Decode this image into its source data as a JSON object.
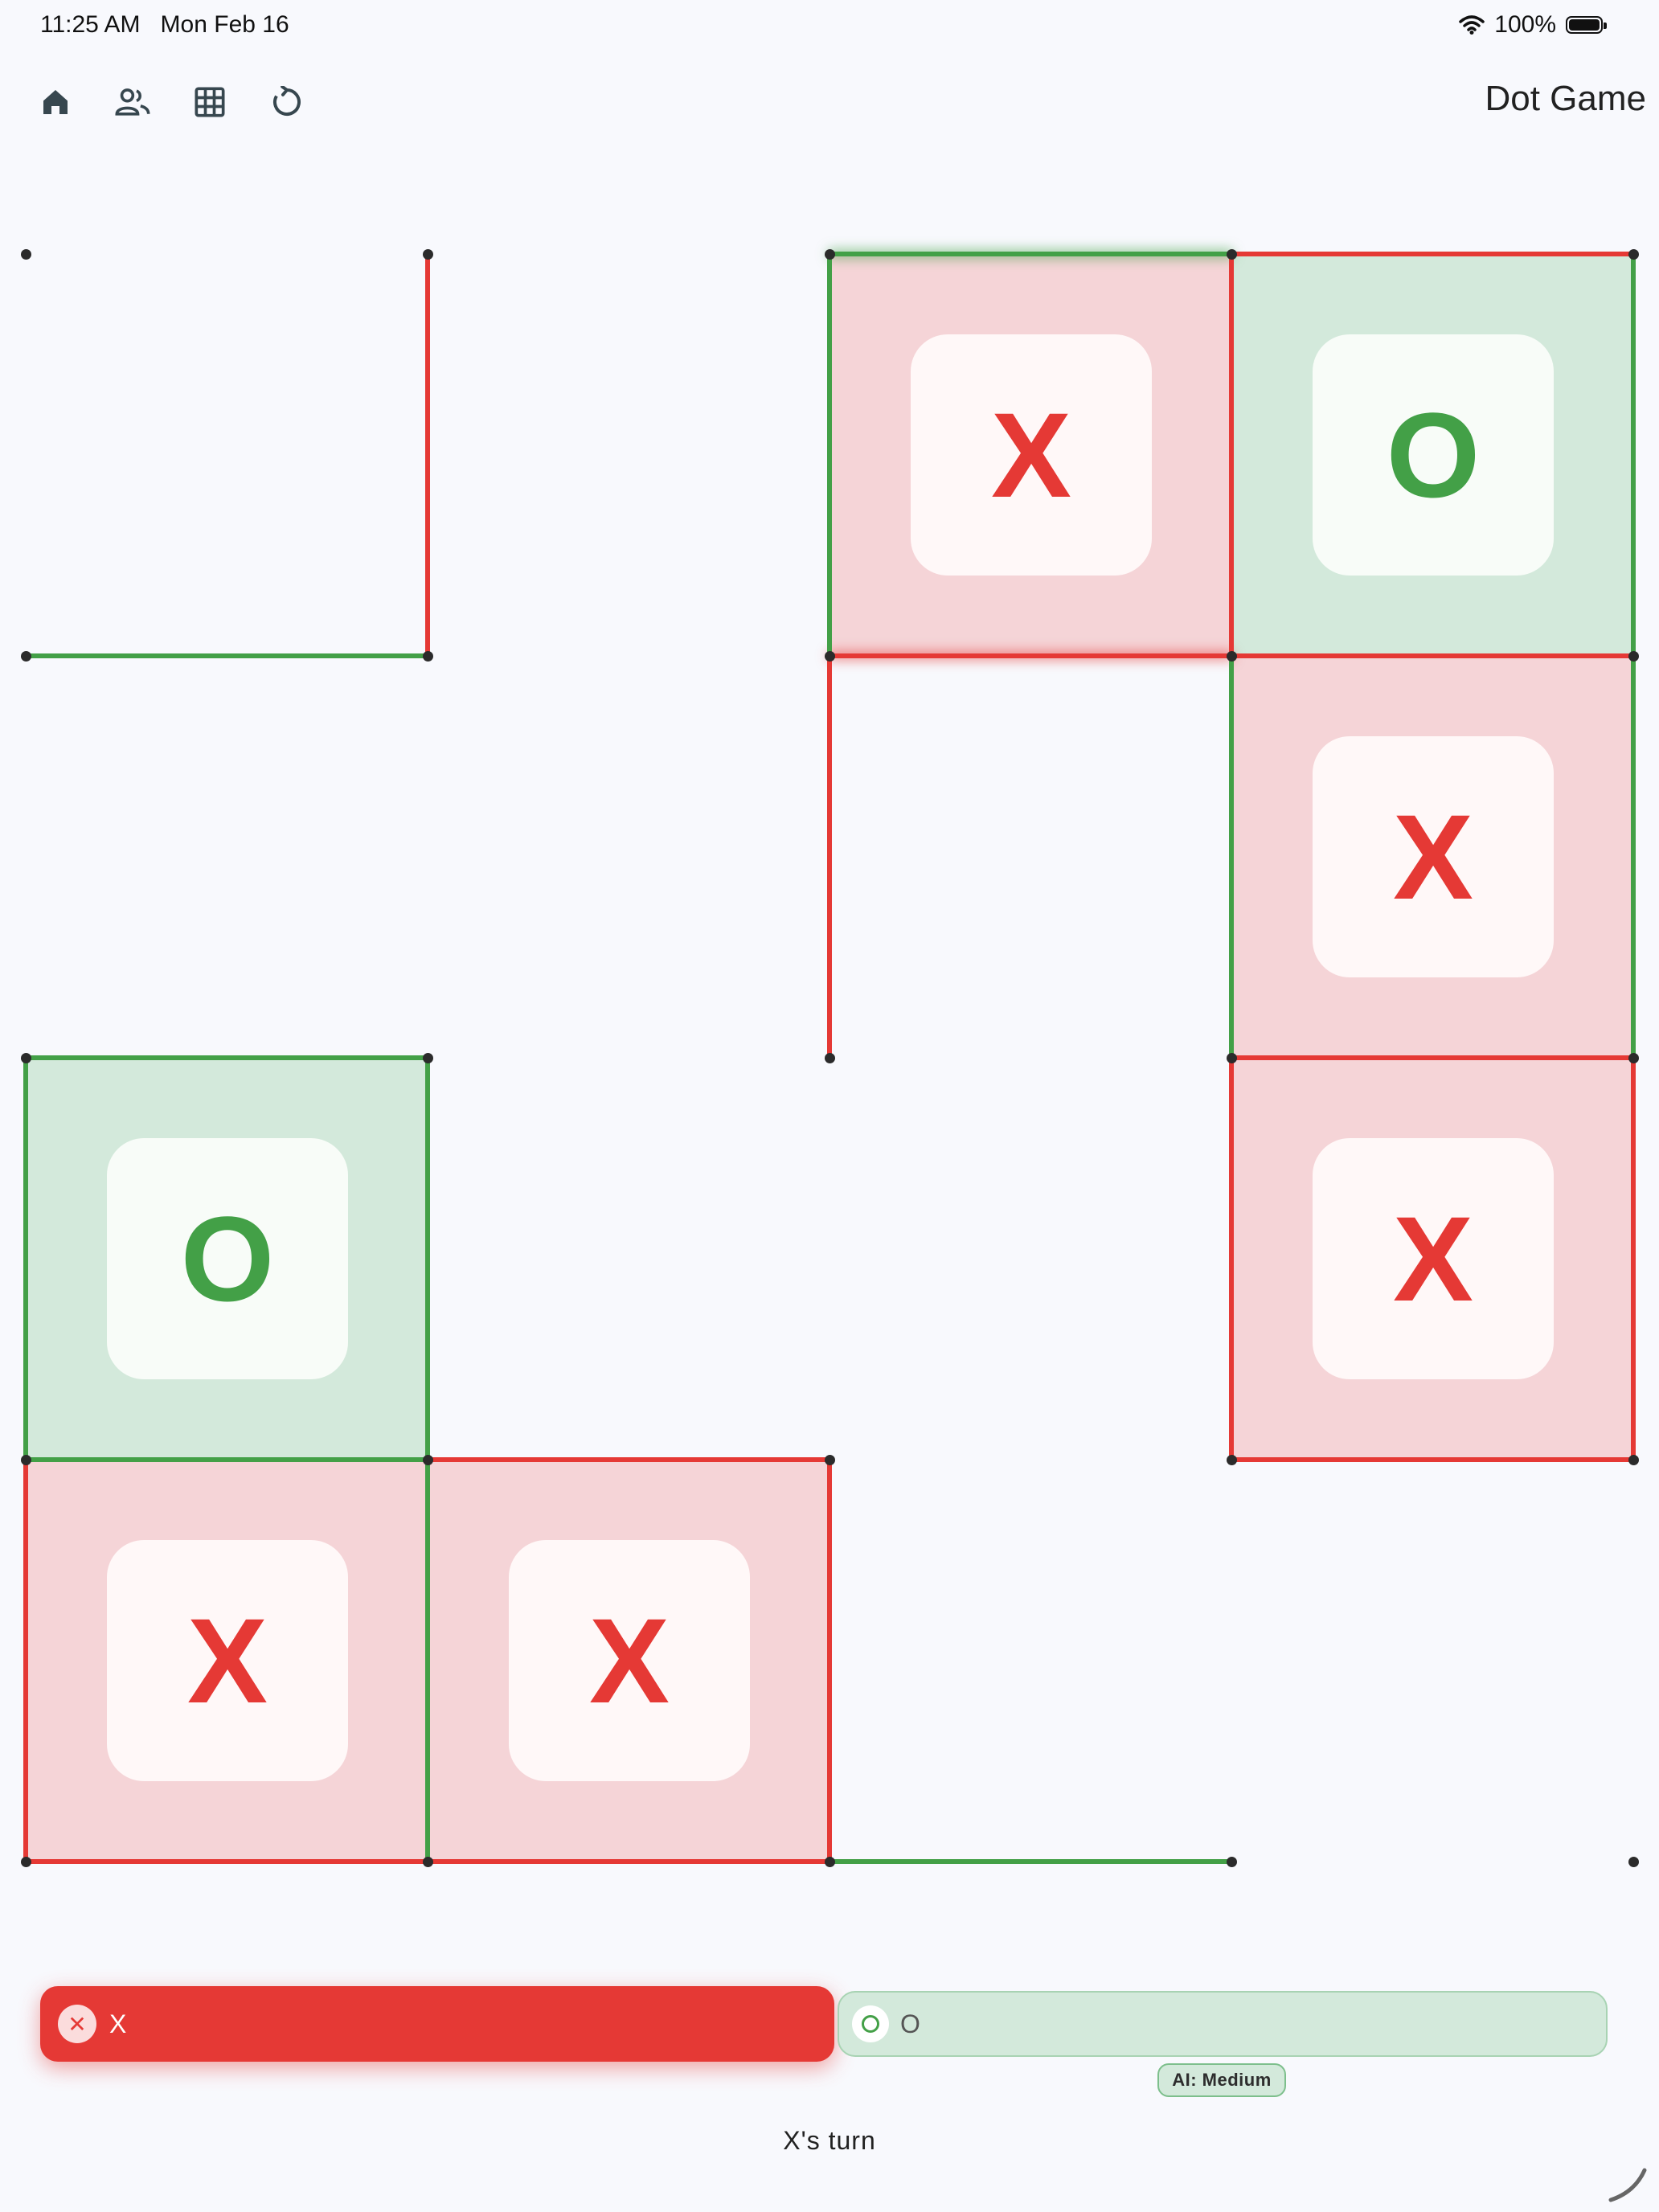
{
  "status_bar": {
    "time": "11:25 AM",
    "date": "Mon Feb 16",
    "battery": "100%",
    "wifi_icon": "wifi-icon",
    "battery_icon": "battery-icon"
  },
  "toolbar": {
    "buttons": [
      {
        "name": "home-button",
        "icon": "home-icon"
      },
      {
        "name": "players-button",
        "icon": "people-icon"
      },
      {
        "name": "grid-size-button",
        "icon": "grid-icon"
      },
      {
        "name": "restart-button",
        "icon": "refresh-icon"
      }
    ]
  },
  "app": {
    "title": "Dot Game"
  },
  "colors": {
    "player_x": "#e53935",
    "player_o": "#43a047",
    "cell_x_bg": "#f5d4d7",
    "cell_o_bg": "#d3e9db",
    "dot": "#2b2b2b",
    "background": "#f8f9fd"
  },
  "board": {
    "grid_dots": 5,
    "cells": [
      {
        "col": 2,
        "row": 0,
        "owner": "X",
        "mark": "X"
      },
      {
        "col": 3,
        "row": 0,
        "owner": "O",
        "mark": "O"
      },
      {
        "col": 3,
        "row": 1,
        "owner": "X",
        "mark": "X"
      },
      {
        "col": 3,
        "row": 2,
        "owner": "X",
        "mark": "X"
      },
      {
        "col": 0,
        "row": 2,
        "owner": "O",
        "mark": "O"
      },
      {
        "col": 0,
        "row": 3,
        "owner": "X",
        "mark": "X"
      },
      {
        "col": 1,
        "row": 3,
        "owner": "X",
        "mark": "X"
      }
    ],
    "h_lines": [
      {
        "col": 2,
        "row": 0,
        "player": "O",
        "last_move": true
      },
      {
        "col": 3,
        "row": 0,
        "player": "X"
      },
      {
        "col": 0,
        "row": 1,
        "player": "O"
      },
      {
        "col": 2,
        "row": 1,
        "player": "X",
        "last_move": true
      },
      {
        "col": 3,
        "row": 1,
        "player": "X"
      },
      {
        "col": 0,
        "row": 2,
        "player": "O"
      },
      {
        "col": 3,
        "row": 2,
        "player": "X"
      },
      {
        "col": 0,
        "row": 3,
        "player": "O"
      },
      {
        "col": 1,
        "row": 3,
        "player": "X"
      },
      {
        "col": 3,
        "row": 3,
        "player": "X"
      },
      {
        "col": 0,
        "row": 4,
        "player": "X"
      },
      {
        "col": 1,
        "row": 4,
        "player": "X"
      },
      {
        "col": 2,
        "row": 4,
        "player": "O"
      }
    ],
    "v_lines": [
      {
        "col": 1,
        "row": 0,
        "player": "X"
      },
      {
        "col": 2,
        "row": 0,
        "player": "O"
      },
      {
        "col": 3,
        "row": 0,
        "player": "X"
      },
      {
        "col": 4,
        "row": 0,
        "player": "O"
      },
      {
        "col": 2,
        "row": 1,
        "player": "X"
      },
      {
        "col": 3,
        "row": 1,
        "player": "O"
      },
      {
        "col": 4,
        "row": 1,
        "player": "O"
      },
      {
        "col": 0,
        "row": 2,
        "player": "O"
      },
      {
        "col": 1,
        "row": 2,
        "player": "O"
      },
      {
        "col": 3,
        "row": 2,
        "player": "X"
      },
      {
        "col": 4,
        "row": 2,
        "player": "X"
      },
      {
        "col": 0,
        "row": 3,
        "player": "X"
      },
      {
        "col": 1,
        "row": 3,
        "player": "O"
      },
      {
        "col": 2,
        "row": 3,
        "player": "X"
      }
    ]
  },
  "players": {
    "x": {
      "name": "X",
      "badge_icon": "x-mark-icon",
      "active": true
    },
    "o": {
      "name": "O",
      "badge_icon": "o-ring-icon",
      "ai_label": "AI: Medium"
    }
  },
  "turn_text": "X's turn"
}
